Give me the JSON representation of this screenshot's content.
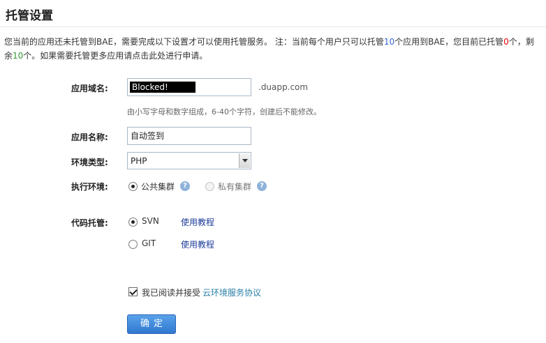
{
  "page": {
    "title": "托管设置"
  },
  "notice": {
    "part1": "您当前的应用还未托管到BAE，需要完成以下设置才可以使用托管服务。 注：当前每个用户只可以托管",
    "max_count": "10",
    "part2": "个应用到BAE，您目前已托管",
    "current_count": "0",
    "part3": "个，剩余",
    "remaining": "10",
    "part4": "个。如果需要托管更多应用请点击此处进行申请。"
  },
  "form": {
    "domain": {
      "label": "应用域名:",
      "value": "Blocked!",
      "suffix": ".duapp.com",
      "hint": "由小写字母和数字组成，6-40个字符，创建后不能修改。"
    },
    "app_name": {
      "label": "应用名称:",
      "value": "自动签到"
    },
    "env_type": {
      "label": "环境类型:",
      "selected": "PHP"
    },
    "runtime": {
      "label": "执行环境:",
      "options": [
        {
          "text": "公共集群",
          "checked": true,
          "disabled": false
        },
        {
          "text": "私有集群",
          "checked": false,
          "disabled": true
        }
      ],
      "help_glyph": "?"
    },
    "code_hosting": {
      "label": "代码托管:",
      "options": [
        {
          "text": "SVN",
          "checked": true,
          "link": "使用教程"
        },
        {
          "text": "GIT",
          "checked": false,
          "link": "使用教程"
        }
      ]
    },
    "agreement": {
      "checked": true,
      "text": "我已阅读并接受",
      "link": "云环境服务协议"
    },
    "submit_label": "确定"
  }
}
